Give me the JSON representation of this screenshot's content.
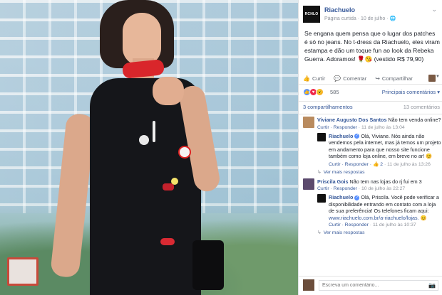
{
  "post": {
    "page_name": "Riachuelo",
    "logo_text": "RCHLO",
    "meta": "Página curtida · 10 de julho · ",
    "globe_icon": "globe-icon",
    "text": "Se engana quem pensa que o lugar dos patches é só no jeans. No t-dress da Riachuelo, eles viram estampa e dão um toque fun ao look da Rebeka Guerra. Adoramos! 🌹😘 (vestido R$ 79,90)",
    "actions": {
      "like": "Curtir",
      "comment": "Comentar",
      "share": "Compartilhar"
    },
    "reaction_count": "585",
    "sort_label": "Principais comentários ▾",
    "shares": "3 compartilhamentos",
    "comments_count": "13 comentários"
  },
  "comments": [
    {
      "name": "Viviane Augusto Dos Santos",
      "text": "Não tem venda online?",
      "reply_label": "Curtir · Responder",
      "time": " · 11 de julho às 13:04",
      "reply": {
        "name": "Riachuelo",
        "text": "Olá, Viviane. Nós ainda não vendemos pela internet, mas já temos um projeto em andamento para que nosso site funcione também como loja online, em breve no ar! 😊",
        "reply_label": "Curtir · Responder · ",
        "likes": "👍 2",
        "time": " · 11 de julho às 13:26"
      },
      "more": "Ver mais respostas"
    },
    {
      "name": "Priscila Gois",
      "text": "Não tem nas lojas do rj fui em 3",
      "reply_label": "Curtir · Responder",
      "time": " · 10 de julho às 22:27",
      "reply": {
        "name": "Riachuelo",
        "text": "Olá, Priscila. Você pode verificar a disponibilidade entrando em contato com a loja de sua preferência! Os telefones ficam aqui:",
        "link": "www.riachuelo.com.br/a-riachuelo/lojas.",
        "text_end": " 😊",
        "reply_label": "Curtir · Responder",
        "time": " · 11 de julho às 10:37"
      },
      "more": "Ver mais respostas"
    }
  ],
  "comment_input": {
    "placeholder": "Escreva um comentário..."
  },
  "colors": {
    "link": "#365899",
    "muted": "#90949c",
    "accent_like": "#5890ff"
  }
}
